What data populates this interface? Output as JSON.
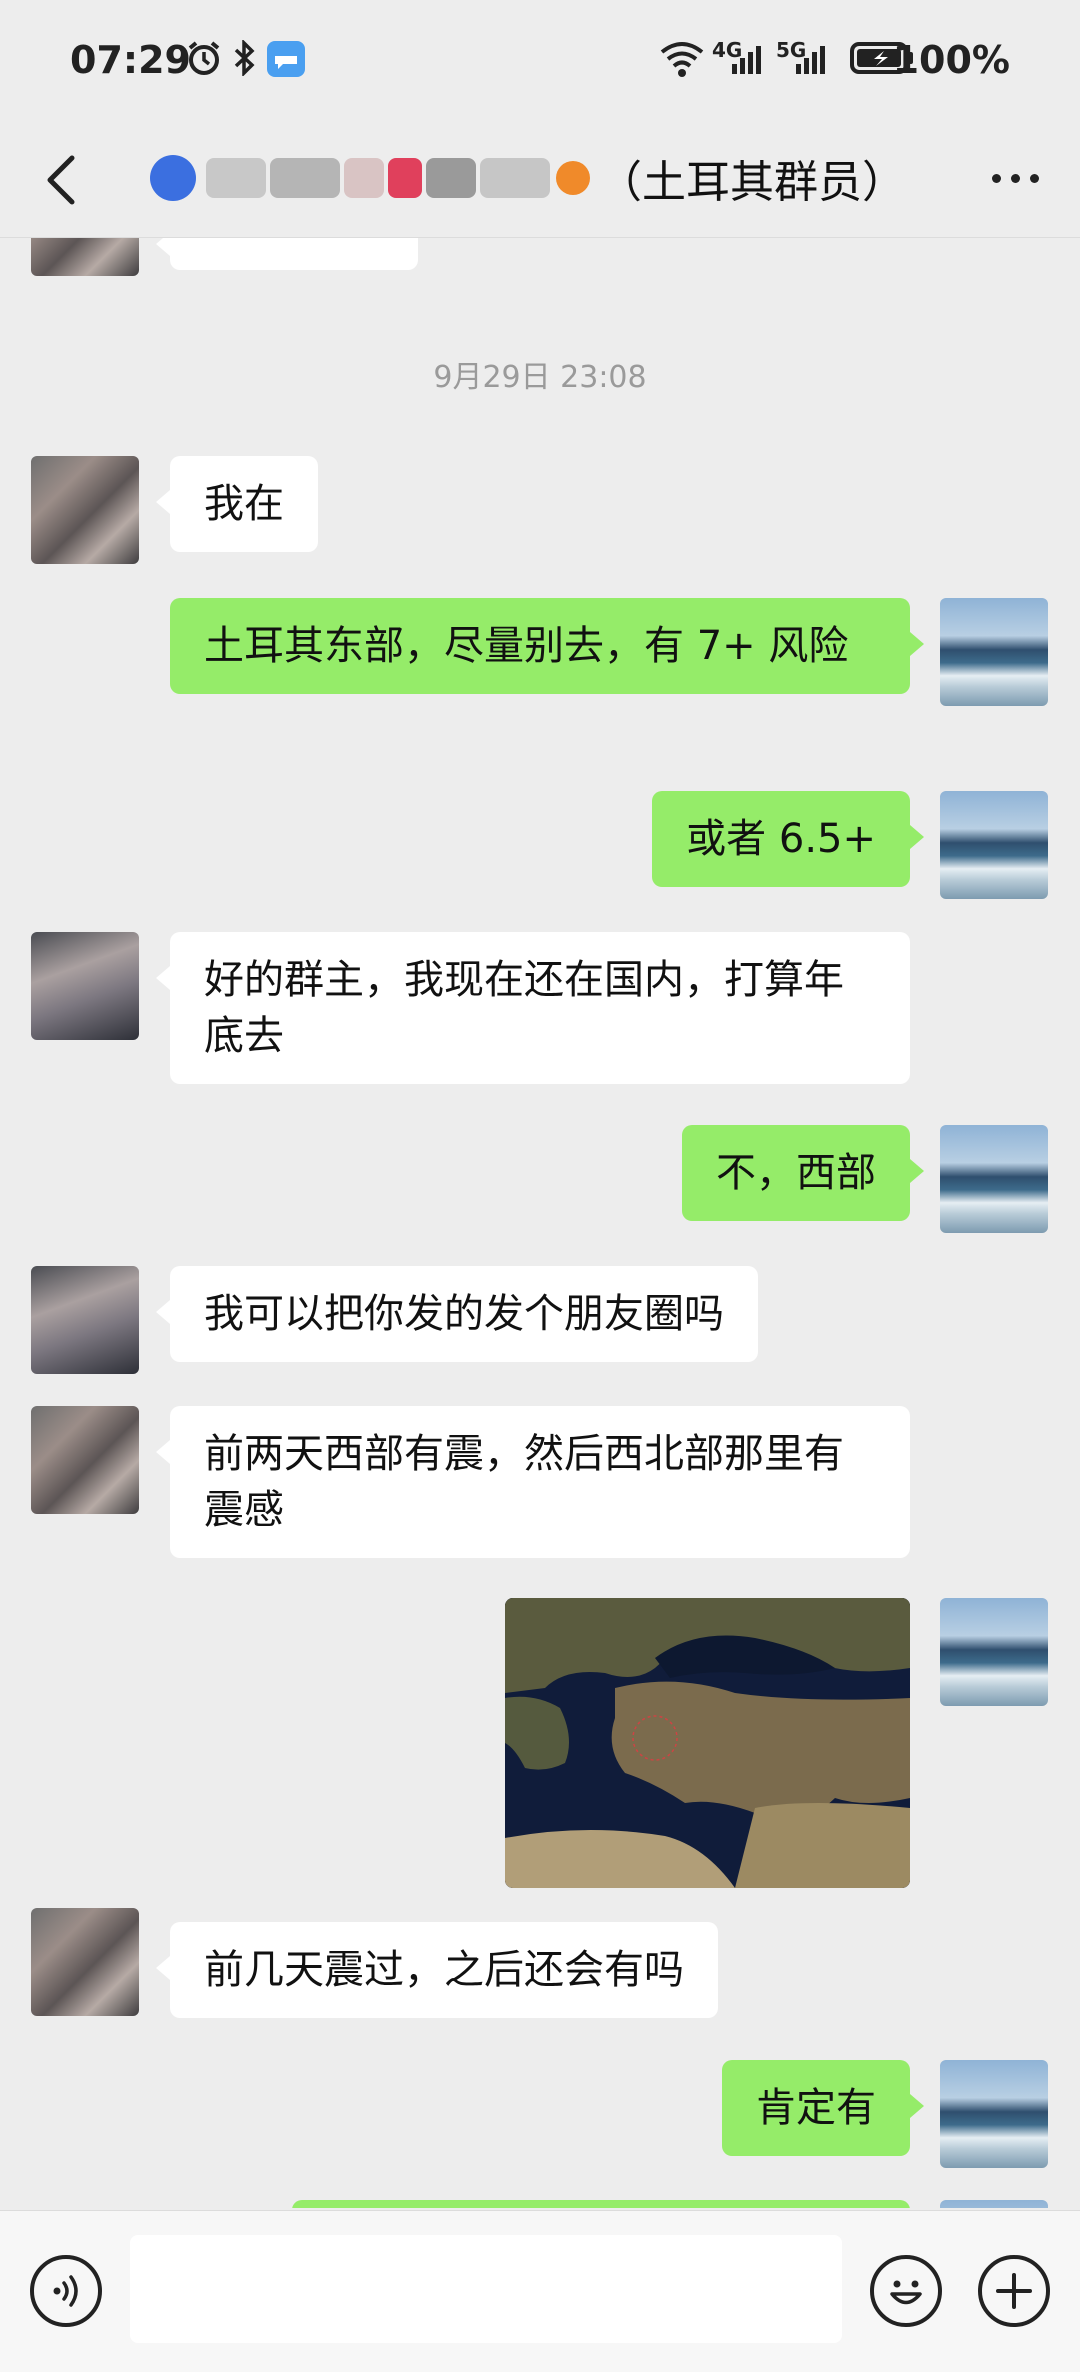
{
  "status_bar": {
    "time": "07:29",
    "network_1": "4G",
    "network_2": "5G",
    "battery": "100%",
    "icons": [
      "alarm-icon",
      "bluetooth-icon",
      "message-icon",
      "wifi-icon",
      "signal-icon",
      "battery-charging-icon"
    ]
  },
  "header": {
    "title_suffix": "（土耳其群员）",
    "back_icon": "chevron-left-icon",
    "more_icon": "more-dots-icon"
  },
  "chat": {
    "timestamp": "9月29日 23:08",
    "messages": [
      {
        "side": "in",
        "text": "我在"
      },
      {
        "side": "out",
        "text": "土耳其东部，尽量别去，有 7+ 风险"
      },
      {
        "side": "out",
        "text": "或者 6.5+"
      },
      {
        "side": "in",
        "text": "好的群主，我现在还在国内，打算年底去"
      },
      {
        "side": "out",
        "text": "不，西部"
      },
      {
        "side": "in",
        "text": "我可以把你发的发个朋友圈吗"
      },
      {
        "side": "in",
        "text": "前两天西部有震，然后西北部那里有震感"
      },
      {
        "side": "out",
        "type": "image",
        "alt": "map-image"
      },
      {
        "side": "in",
        "text": "前几天震过，之后还会有吗"
      },
      {
        "side": "out",
        "text": "肯定有"
      }
    ]
  },
  "input_bar": {
    "voice_icon": "voice-icon",
    "emoji_icon": "emoji-icon",
    "plus_icon": "plus-icon",
    "placeholder": ""
  },
  "colors": {
    "background": "#ededed",
    "bubble_out": "#95ec69",
    "bubble_in": "#ffffff"
  }
}
